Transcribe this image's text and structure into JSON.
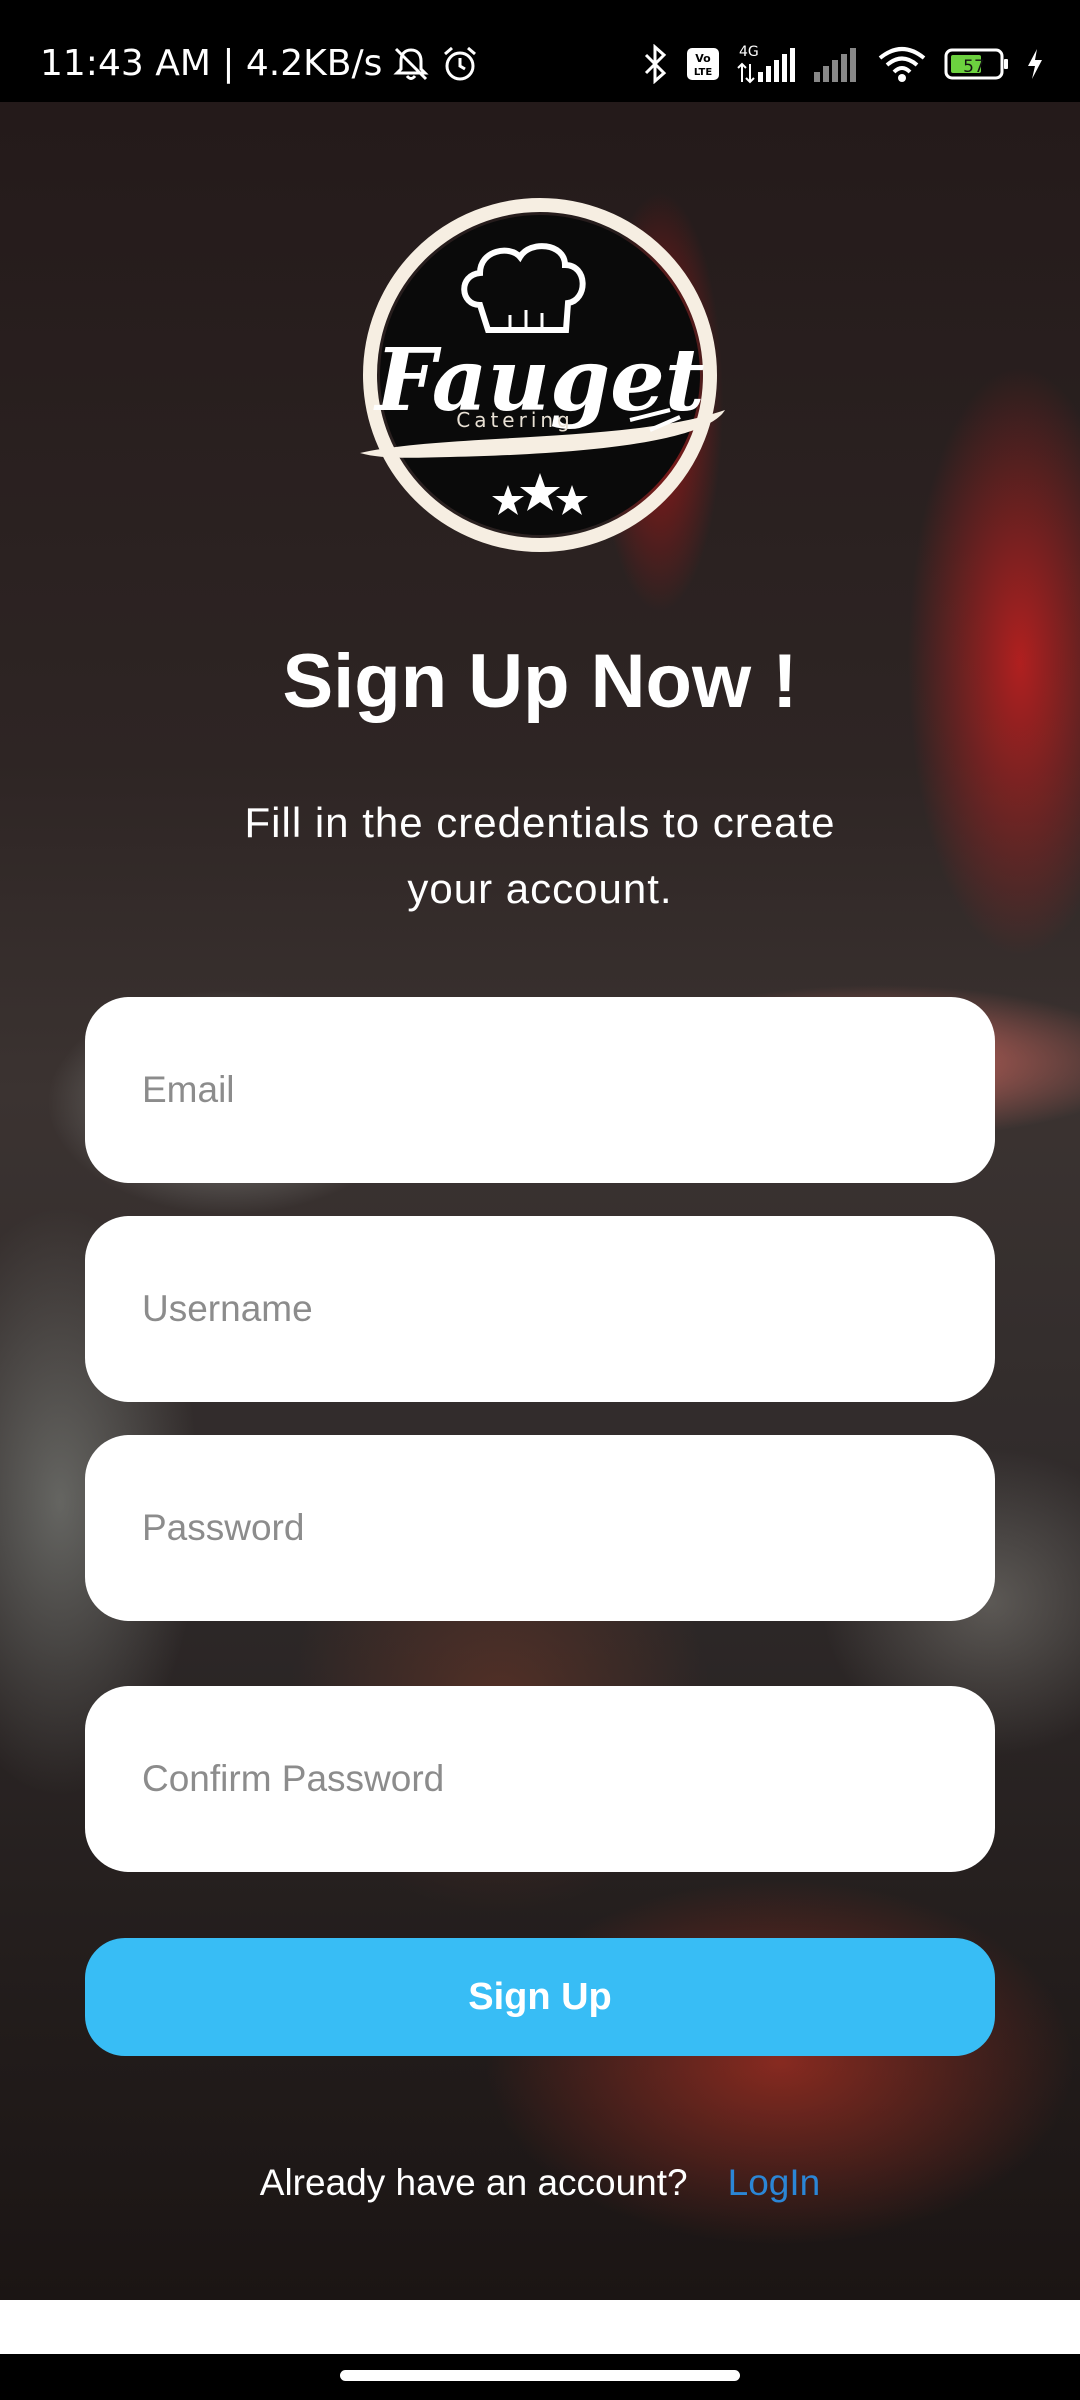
{
  "status_bar": {
    "time_speed": "11:43 AM | 4.2KB/s",
    "network_label": "4G",
    "volte_label": "Vo LTE",
    "battery_level": "57",
    "icons": [
      "mute-bell-icon",
      "alarm-icon",
      "bluetooth-icon",
      "volte-icon",
      "signal-icon",
      "signal-icon",
      "wifi-icon",
      "battery-icon",
      "charging-icon"
    ]
  },
  "logo": {
    "brand": "Fauget",
    "tagline": "Catering",
    "icons": [
      "chef-hat-icon",
      "star-icon"
    ]
  },
  "header": {
    "title": "Sign Up Now !",
    "subtitle": "Fill in the credentials to create your account."
  },
  "form": {
    "email_placeholder": "Email",
    "username_placeholder": "Username",
    "password_placeholder": "Password",
    "confirm_password_placeholder": "Confirm Password",
    "submit_label": "Sign Up"
  },
  "footer": {
    "prompt": "Already have an account?",
    "login_label": "LogIn"
  },
  "colors": {
    "button": "#38bdf5",
    "link": "#2b86d6",
    "input_bg": "#ffffff",
    "text": "#ffffff"
  }
}
